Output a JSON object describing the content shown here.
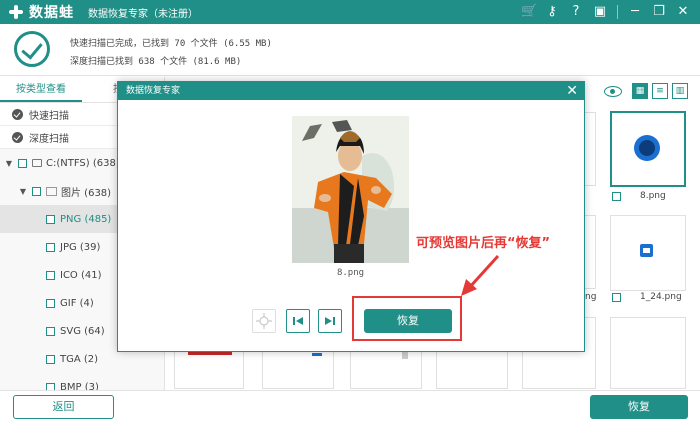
{
  "titlebar": {
    "app_name": "数据蛙",
    "subtitle": "数据恢复专家（未注册）",
    "icons": [
      "cart-icon",
      "key-icon",
      "help-icon",
      "save-icon",
      "minimize-icon",
      "restore-icon",
      "close-icon"
    ]
  },
  "summary": {
    "quick_scan": "快速扫描已完成，已找到 70 个文件 (6.55 MB)",
    "deep_scan": "深度扫描已找到 638 个文件 (81.6 MB)"
  },
  "sidebar": {
    "tabs": [
      {
        "label": "按类型查看",
        "active": true
      },
      {
        "label": "按路",
        "active": false
      }
    ],
    "scan_modes": [
      "快速扫描",
      "深度扫描"
    ],
    "drive": "C:(NTFS) (638)",
    "folder": "图片 (638)",
    "types": [
      {
        "label": "PNG (485)",
        "selected": true
      },
      {
        "label": "JPG (39)",
        "selected": false
      },
      {
        "label": "ICO (41)",
        "selected": false
      },
      {
        "label": "GIF (4)",
        "selected": false
      },
      {
        "label": "SVG (64)",
        "selected": false
      },
      {
        "label": "TGA (2)",
        "selected": false
      },
      {
        "label": "BMP (3)",
        "selected": false
      }
    ]
  },
  "grid": {
    "files": [
      "8.png",
      "1_24.png"
    ],
    "partial_label": "ng"
  },
  "modal": {
    "title": "数据恢复专家",
    "filename": "8.png",
    "recover_label": "恢复"
  },
  "annotation": "可预览图片后再“恢复”",
  "footer": {
    "back_label": "返回",
    "recover_label": "恢复"
  },
  "colors": {
    "accent": "#1f8f87",
    "annotation": "#e53935"
  }
}
